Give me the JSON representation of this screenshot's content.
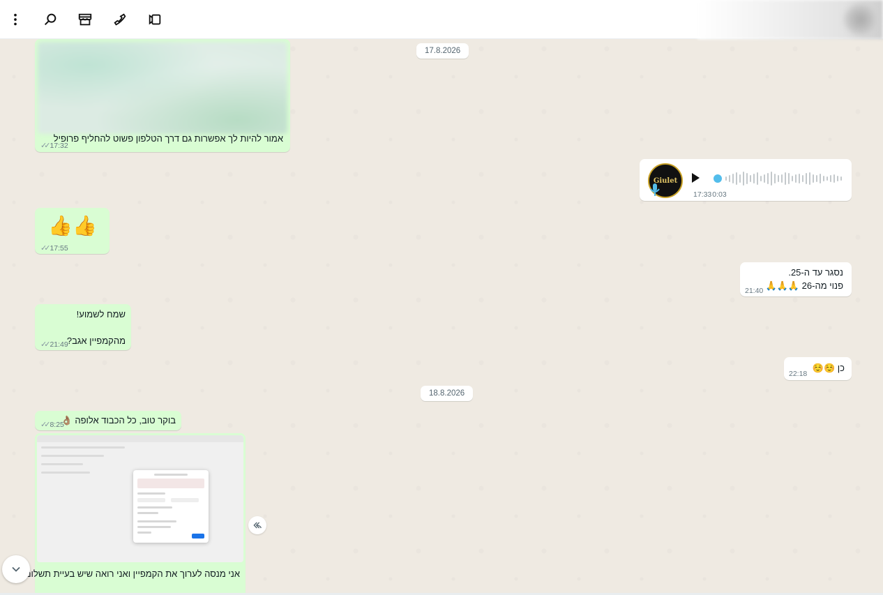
{
  "header": {
    "icons": [
      "menu-icon",
      "search-icon",
      "store-icon",
      "phone-icon",
      "video-icon"
    ]
  },
  "dates": [
    "17.8.2026",
    "18.8.2026"
  ],
  "messages": {
    "m1": {
      "text": "אמור להיות לך אפשרות גם דרך הטלפון פשוט להחליף פרופיל",
      "time": "17:32"
    },
    "m2": {
      "time": "17:33",
      "duration": "0:03",
      "avatar_text": "Giulet"
    },
    "m3": {
      "text": "👍👍",
      "time": "17:55"
    },
    "m4": {
      "line1": "נסגר עד ה-25.",
      "line2": "פנוי מה-26 🙏🙏🙏",
      "time": "21:40"
    },
    "m5": {
      "line1": "שמח לשמוע!",
      "line2": "מהקמפיין אגב?",
      "time": "21:49"
    },
    "m6": {
      "text": "כן ☺️☺️",
      "time": "22:18"
    },
    "m7": {
      "text": "בוקר טוב, כל הכבוד אלופה 👌🏽",
      "time": "8:25"
    },
    "m8": {
      "text": "אני מנסה לערוך את הקמפיין ואני רואה שיש בעיית תשלום"
    }
  },
  "colors": {
    "incoming_bubble": "#d9fdd3",
    "outgoing_bubble": "#ffffff",
    "chat_background": "#efeae2",
    "audio_accent": "#53bdeb"
  }
}
